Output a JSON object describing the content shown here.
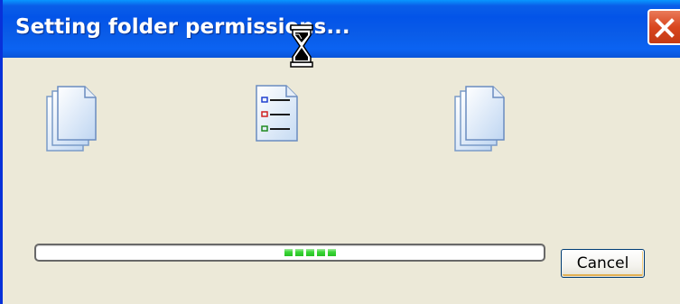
{
  "window": {
    "title": "Setting folder permissions...",
    "close_icon": "close-icon"
  },
  "animation": {
    "source_icon": "document-stack-icon",
    "moving_icon": "checklist-document-icon",
    "target_icon": "document-stack-icon"
  },
  "cursor": {
    "icon": "hourglass-icon"
  },
  "progress": {
    "style": "marquee",
    "segments": 5
  },
  "buttons": {
    "cancel_label": "Cancel"
  },
  "colors": {
    "titlebar": "#0A5CE8",
    "window_body": "#ECE9D8",
    "close_button": "#D9461E",
    "progress_green": "#3DD83A",
    "button_border": "#003C74"
  }
}
